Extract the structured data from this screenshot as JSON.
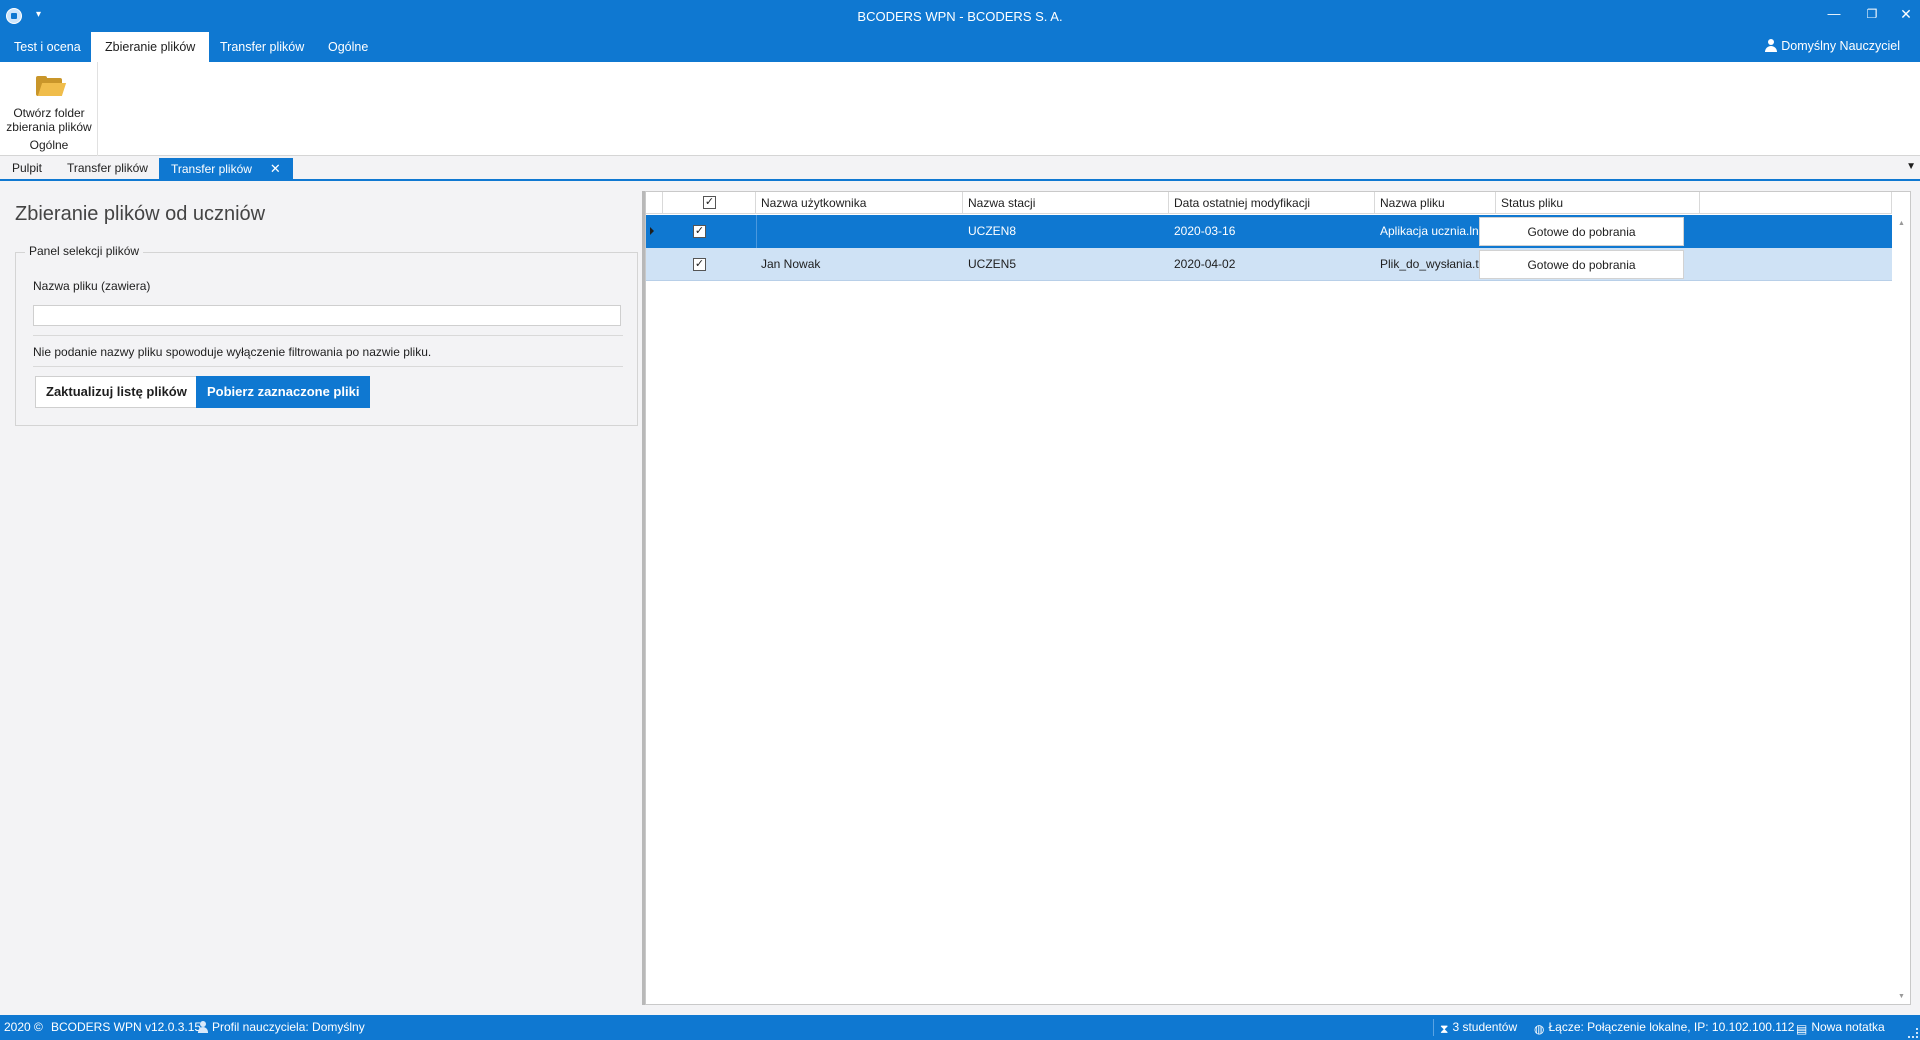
{
  "window": {
    "title": "BCODERS WPN - BCODERS S. A.",
    "minimize": "—",
    "maximize": "❐",
    "close": "✕",
    "quick_access": "▾"
  },
  "ribbon_tabs": [
    "Test i ocena",
    "Zbieranie plików",
    "Transfer plików",
    "Ogólne"
  ],
  "user": "Domyślny Nauczyciel",
  "ribbon": {
    "open_folder_line1": "Otwórz folder",
    "open_folder_line2": "zbierania plików",
    "group_label": "Ogólne"
  },
  "doc_tabs": [
    "Pulpit",
    "Transfer plików",
    "Transfer plików"
  ],
  "doc_tab_close": "✕",
  "doc_dropdown": "▼",
  "panel": {
    "title": "Zbieranie plików od uczniów",
    "legend": "Panel selekcji plików",
    "file_name_label": "Nazwa pliku (zawiera)",
    "file_name_value": "",
    "hint": "Nie podanie nazwy pliku spowoduje wyłączenie filtrowania po nazwie pliku.",
    "refresh_button": "Zaktualizuj listę plików",
    "download_button": "Pobierz zaznaczone pliki"
  },
  "grid": {
    "check_all": "✓",
    "columns": [
      "Nazwa użytkownika",
      "Nazwa stacji",
      "Data ostatniej modyfikacji",
      "Nazwa pliku",
      "Status pliku"
    ],
    "rows": [
      {
        "checked": "✓",
        "user": "",
        "station": "UCZEN8",
        "modified": "2020-03-16",
        "file": "Aplikacja ucznia.lnk",
        "status": "Gotowe do pobrania"
      },
      {
        "checked": "✓",
        "user": "Jan Nowak",
        "station": "UCZEN5",
        "modified": "2020-04-02",
        "file": "Plik_do_wysłania.txt",
        "status": "Gotowe do pobrania"
      }
    ]
  },
  "statusbar": {
    "copyright": "2020 ©",
    "version": "BCODERS WPN v12.0.3.15",
    "profile": "Profil nauczyciela: Domyślny",
    "students": "3 studentów",
    "connection": "Łącze: Połączenie lokalne, IP: 10.102.100.112",
    "note": "Nowa notatka"
  }
}
